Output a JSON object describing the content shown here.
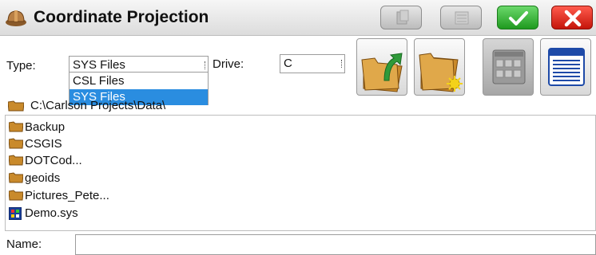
{
  "window": {
    "title": "Coordinate Projection"
  },
  "toolbar": {
    "buttons": [
      {
        "name": "copy-button",
        "icon": "copy-icon",
        "state": "disabled"
      },
      {
        "name": "list-button",
        "icon": "list-icon",
        "state": "disabled"
      },
      {
        "name": "ok-button",
        "icon": "checkmark-icon",
        "color": "#1f9a1f"
      },
      {
        "name": "close-button",
        "icon": "close-icon",
        "color": "#c5150a"
      }
    ]
  },
  "filter": {
    "type_label": "Type:",
    "type_value": "SYS Files",
    "drive_label": "Drive:",
    "drive_value": "C",
    "type_options": [
      "CSL Files",
      "SYS Files"
    ],
    "selected_option": "SYS Files"
  },
  "actions": [
    {
      "name": "up-folder-button",
      "icon": "folder-up-icon"
    },
    {
      "name": "new-folder-button",
      "icon": "folder-new-icon"
    },
    {
      "name": "icon-view-button",
      "icon": "icon-view-icon"
    },
    {
      "name": "details-view-button",
      "icon": "details-view-icon"
    }
  ],
  "path": "C:\\Carlson Projects\\Data\\",
  "files": [
    {
      "name": "Backup",
      "kind": "folder"
    },
    {
      "name": "CSGIS",
      "kind": "folder"
    },
    {
      "name": "DOTCod...",
      "kind": "folder"
    },
    {
      "name": "geoids",
      "kind": "folder"
    },
    {
      "name": "Pictures_Pete...",
      "kind": "folder"
    },
    {
      "name": "Demo.sys",
      "kind": "sys-file"
    }
  ],
  "name_field": {
    "label": "Name:",
    "value": ""
  },
  "colors": {
    "selection": "#2a8de0",
    "accent_ok": "#1f9a1f",
    "accent_close": "#c5150a",
    "folder": "#c98a2b"
  }
}
